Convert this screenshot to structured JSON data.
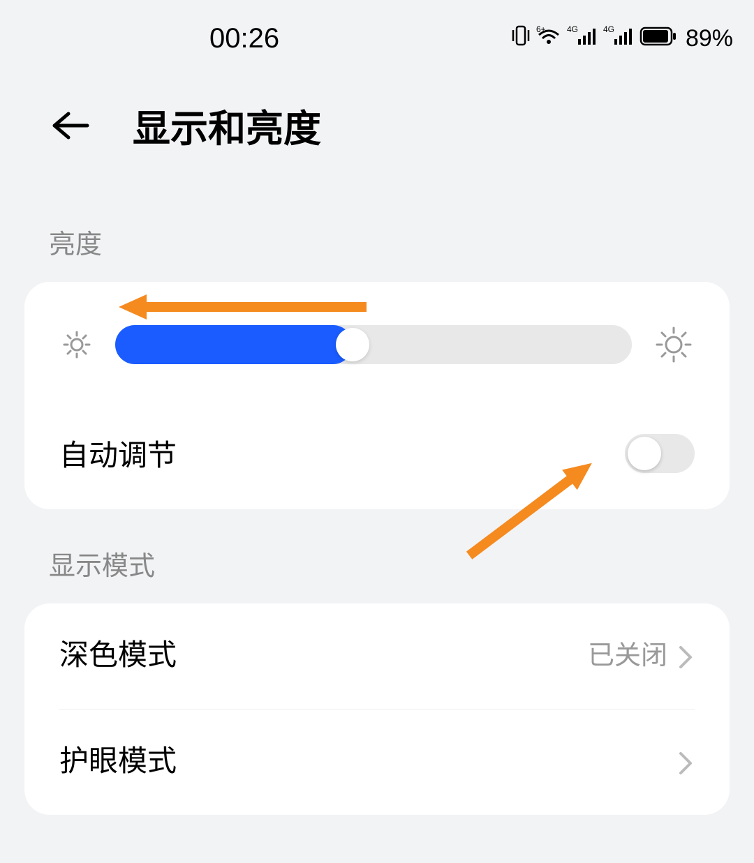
{
  "statusBar": {
    "time": "00:26",
    "batteryPercent": "89%"
  },
  "header": {
    "title": "显示和亮度"
  },
  "sections": {
    "brightness": {
      "label": "亮度",
      "sliderPercent": 46,
      "autoAdjust": {
        "label": "自动调节",
        "enabled": false
      }
    },
    "displayMode": {
      "label": "显示模式",
      "items": [
        {
          "label": "深色模式",
          "value": "已关闭"
        },
        {
          "label": "护眼模式",
          "value": ""
        }
      ]
    }
  }
}
